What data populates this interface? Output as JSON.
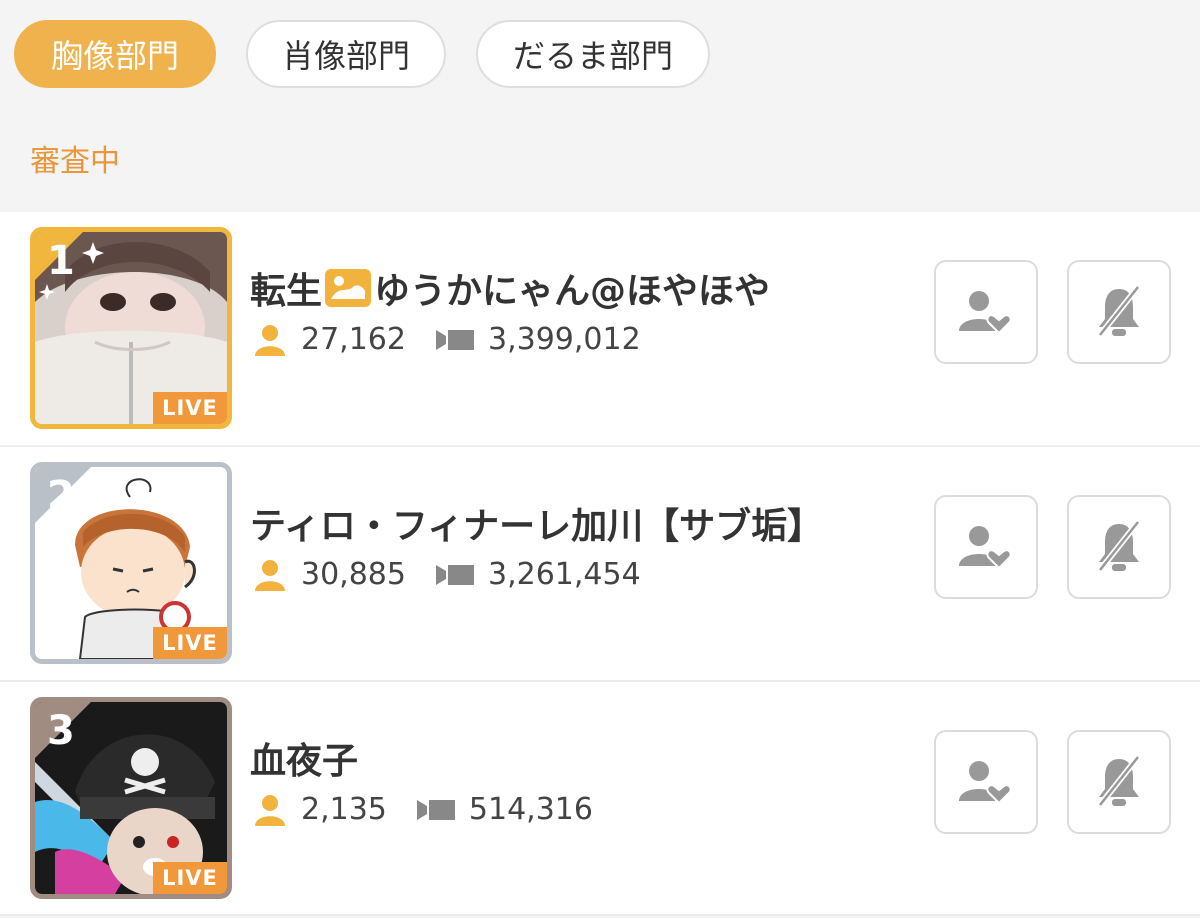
{
  "tabs": [
    {
      "label": "胸像部門",
      "active": true
    },
    {
      "label": "肖像部門",
      "active": false
    },
    {
      "label": "だるま部門",
      "active": false
    }
  ],
  "status_label": "審査中",
  "colors": {
    "accent": "#f0b24c",
    "status": "#e8983a",
    "live_badge": "#f0983a",
    "rank1": "#f0b63e",
    "rank2": "#b9c0c8",
    "rank3": "#a08c80"
  },
  "rankings": [
    {
      "rank": "1",
      "name_prefix": "転生",
      "name_suffix": "ゆうかにゃん@ほやほや",
      "followers": "27,162",
      "views": "3,399,012",
      "badge": "LIVE"
    },
    {
      "rank": "2",
      "name": "ティロ・フィナーレ加川【サブ垢】",
      "followers": "30,885",
      "views": "3,261,454",
      "badge": "LIVE"
    },
    {
      "rank": "3",
      "name": "血夜子",
      "followers": "2,135",
      "views": "514,316",
      "badge": "LIVE"
    }
  ],
  "icons": {
    "followers": "person-icon",
    "views": "video-camera-icon",
    "follow_button": "follow-heart-icon",
    "notify_button": "bell-off-icon"
  }
}
